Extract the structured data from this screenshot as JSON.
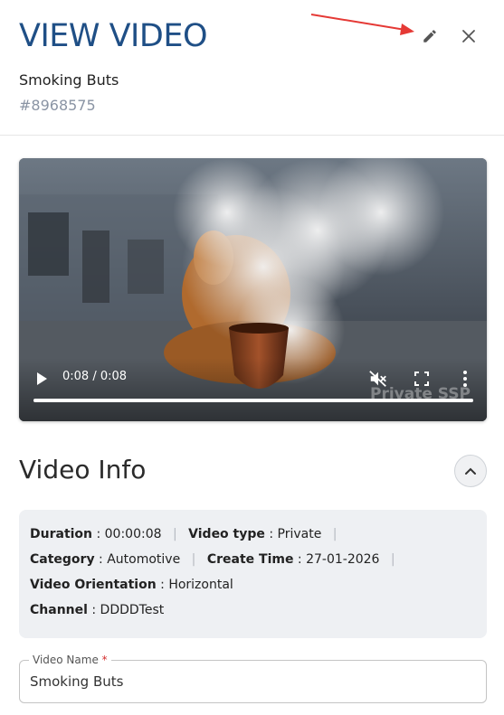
{
  "header": {
    "title": "VIEW VIDEO",
    "video_title": "Smoking Buts",
    "video_id": "#8968575",
    "edit_icon": "pencil-icon",
    "close_icon": "close-icon"
  },
  "player": {
    "time": "0:08 / 0:08",
    "progress": 1.0,
    "watermark": "Private SSP",
    "icons": [
      "play-icon",
      "volume-muted-icon",
      "fullscreen-icon",
      "more-vert-icon"
    ]
  },
  "video_info": {
    "section_title": "Video Info",
    "duration_label": "Duration",
    "duration_value": "00:00:08",
    "video_type_label": "Video type",
    "video_type_value": "Private",
    "category_label": "Category",
    "category_value": "Automotive",
    "create_time_label": "Create Time",
    "create_time_value": "27-01-2026",
    "orientation_label": "Video Orientation",
    "orientation_value": "Horizontal",
    "channel_label": "Channel",
    "channel_value": "DDDDTest"
  },
  "form": {
    "video_name_label": "Video Name",
    "required_mark": "*",
    "video_name_value": "Smoking Buts"
  },
  "colors": {
    "title": "#1f4f86",
    "id_text": "#8a94a4",
    "info_bg": "#eef0f3",
    "annotation_arrow": "#e53935"
  }
}
